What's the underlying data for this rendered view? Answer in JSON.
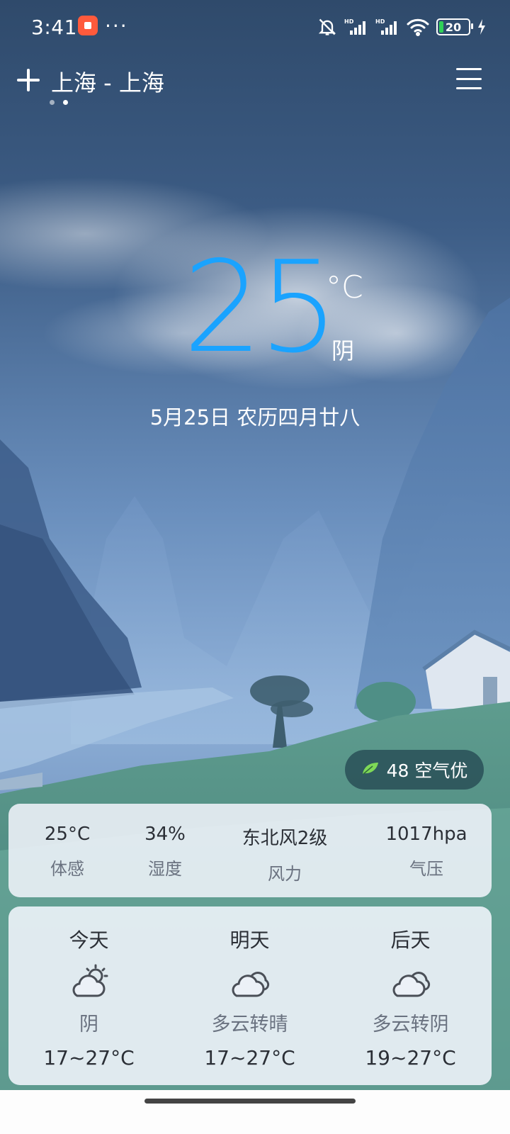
{
  "status_bar": {
    "time": "3:41",
    "more": "···",
    "battery_level": "20",
    "icons": [
      "app-icon",
      "bell-off-icon",
      "signal-hd-icon",
      "signal-hd-icon",
      "wifi-icon",
      "battery-icon",
      "charging-icon"
    ]
  },
  "header": {
    "city": "上海 - 上海",
    "page_count": 2,
    "active_page": 2
  },
  "current": {
    "temperature": "25",
    "unit": "°C",
    "condition": "阴",
    "date": "5月25日 农历四月廿八"
  },
  "aqi": {
    "value": "48",
    "label": "空气优",
    "text": "48 空气优",
    "icon": "leaf-icon",
    "color": "#7ed957"
  },
  "details": [
    {
      "value": "25°C",
      "label": "体感"
    },
    {
      "value": "34%",
      "label": "湿度"
    },
    {
      "value": "东北风2级",
      "label": "风力"
    },
    {
      "value": "1017hpa",
      "label": "气压"
    }
  ],
  "forecast": [
    {
      "day": "今天",
      "icon": "cloud-sun-icon",
      "desc": "阴",
      "range": "17~27°C"
    },
    {
      "day": "明天",
      "icon": "cloudy-icon",
      "desc": "多云转晴",
      "range": "17~27°C"
    },
    {
      "day": "后天",
      "icon": "cloudy-icon",
      "desc": "多云转阴",
      "range": "19~27°C"
    }
  ],
  "colors": {
    "temperature_accent": "#1aa3ff",
    "card_background": "#ecf1f7"
  }
}
